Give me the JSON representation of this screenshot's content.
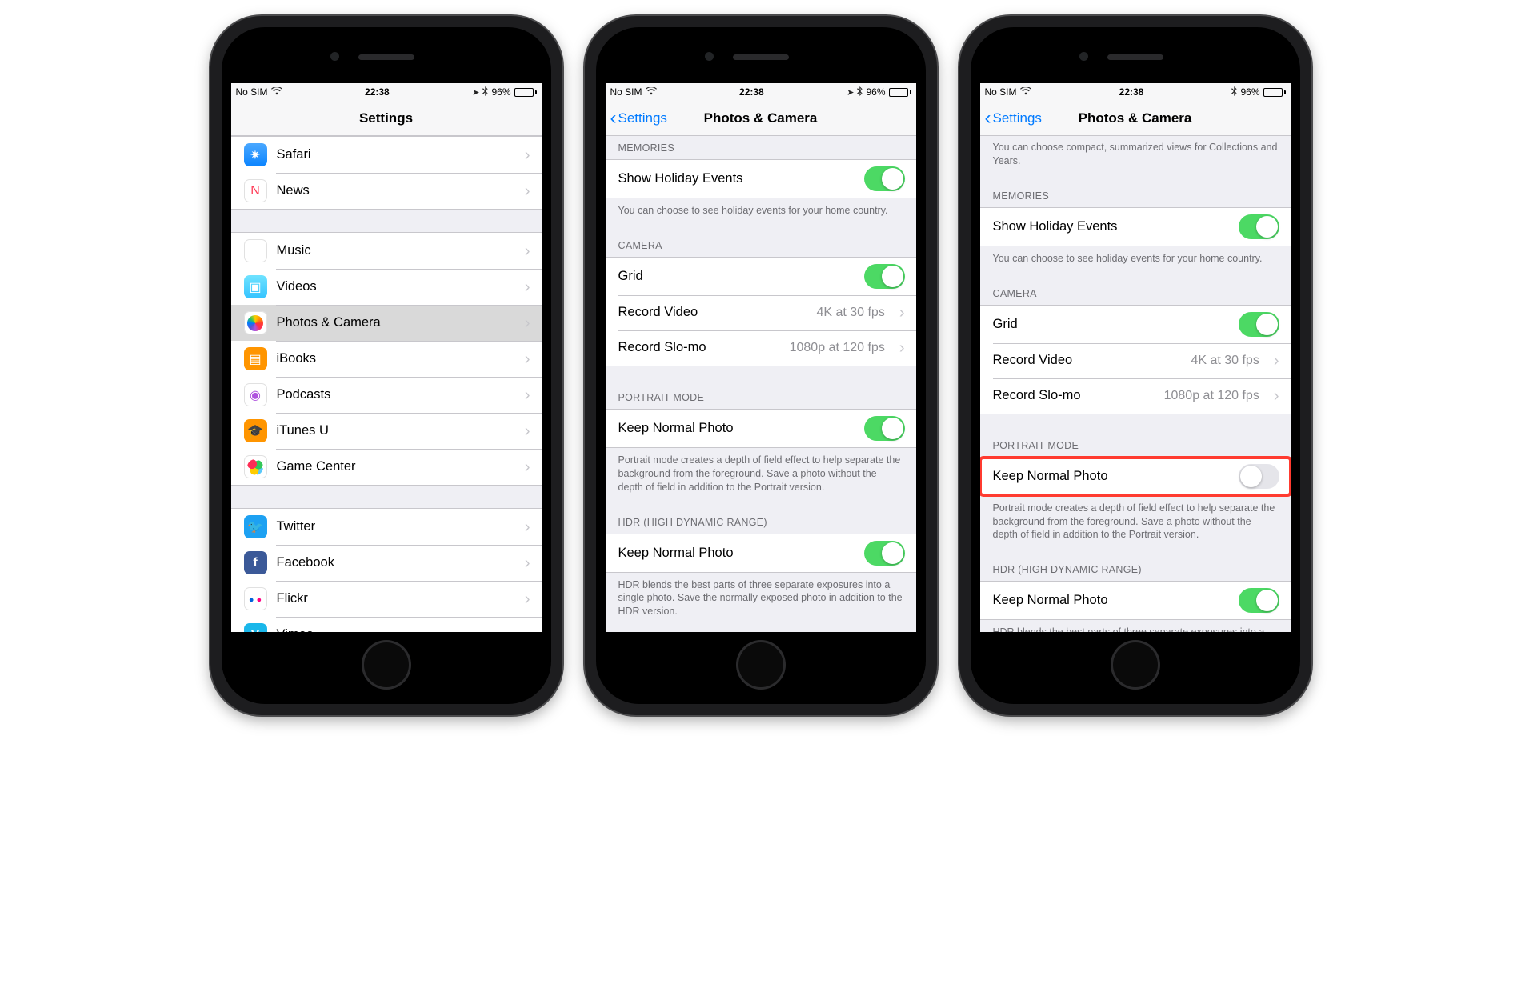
{
  "status": {
    "carrier": "No SIM",
    "time": "22:38",
    "battery_pct": "96%",
    "show_location_icon": true,
    "show_bluetooth_icon": true
  },
  "screen1": {
    "nav_title": "Settings",
    "groups": [
      {
        "items": [
          {
            "icon": "safari",
            "label": "Safari"
          },
          {
            "icon": "news",
            "label": "News"
          }
        ]
      },
      {
        "items": [
          {
            "icon": "music",
            "label": "Music"
          },
          {
            "icon": "videos",
            "label": "Videos"
          },
          {
            "icon": "photos",
            "label": "Photos & Camera",
            "selected": true
          },
          {
            "icon": "ibooks",
            "label": "iBooks"
          },
          {
            "icon": "podcasts",
            "label": "Podcasts"
          },
          {
            "icon": "itunesu",
            "label": "iTunes U"
          },
          {
            "icon": "gc",
            "label": "Game Center"
          }
        ]
      },
      {
        "items": [
          {
            "icon": "twitter",
            "label": "Twitter"
          },
          {
            "icon": "facebook",
            "label": "Facebook"
          },
          {
            "icon": "flickr",
            "label": "Flickr"
          },
          {
            "icon": "vimeo",
            "label": "Vimeo"
          }
        ]
      }
    ]
  },
  "screen2": {
    "nav_back": "Settings",
    "nav_title": "Photos & Camera",
    "memories_header": "MEMORIES",
    "show_holiday_label": "Show Holiday Events",
    "show_holiday_on": true,
    "memories_footer": "You can choose to see holiday events for your home country.",
    "camera_header": "CAMERA",
    "grid_label": "Grid",
    "grid_on": true,
    "record_video_label": "Record Video",
    "record_video_value": "4K at 30 fps",
    "record_slomo_label": "Record Slo-mo",
    "record_slomo_value": "1080p at 120 fps",
    "portrait_header": "PORTRAIT MODE",
    "portrait_keep_label": "Keep Normal Photo",
    "portrait_keep_on": true,
    "portrait_footer": "Portrait mode creates a depth of field effect to help separate the background from the foreground. Save a photo without the depth of field in addition to the Portrait version.",
    "hdr_header": "HDR (HIGH DYNAMIC RANGE)",
    "hdr_keep_label": "Keep Normal Photo",
    "hdr_keep_on": true,
    "hdr_footer": "HDR blends the best parts of three separate exposures into a single photo. Save the normally exposed photo in addition to the HDR version."
  },
  "screen3": {
    "nav_back": "Settings",
    "nav_title": "Photos & Camera",
    "top_footer": "You can choose compact, summarized views for Collections and Years.",
    "memories_header": "MEMORIES",
    "show_holiday_label": "Show Holiday Events",
    "show_holiday_on": true,
    "memories_footer": "You can choose to see holiday events for your home country.",
    "camera_header": "CAMERA",
    "grid_label": "Grid",
    "grid_on": true,
    "record_video_label": "Record Video",
    "record_video_value": "4K at 30 fps",
    "record_slomo_label": "Record Slo-mo",
    "record_slomo_value": "1080p at 120 fps",
    "portrait_header": "PORTRAIT MODE",
    "portrait_keep_label": "Keep Normal Photo",
    "portrait_keep_on": false,
    "portrait_highlight": true,
    "portrait_footer": "Portrait mode creates a depth of field effect to help separate the background from the foreground. Save a photo without the depth of field in addition to the Portrait version.",
    "hdr_header": "HDR (HIGH DYNAMIC RANGE)",
    "hdr_keep_label": "Keep Normal Photo",
    "hdr_keep_on": true,
    "hdr_footer": "HDR blends the best parts of three separate exposures into a single photo. Save the normally exposed photo in addition to the HDR version."
  },
  "icons_glyph": {
    "safari": "✷",
    "news": "N",
    "music": "♪",
    "videos": "▣",
    "ibooks": "▤",
    "podcasts": "◉",
    "itunesu": "🎓",
    "twitter": "🐦",
    "facebook": "f",
    "vimeo": "V"
  }
}
